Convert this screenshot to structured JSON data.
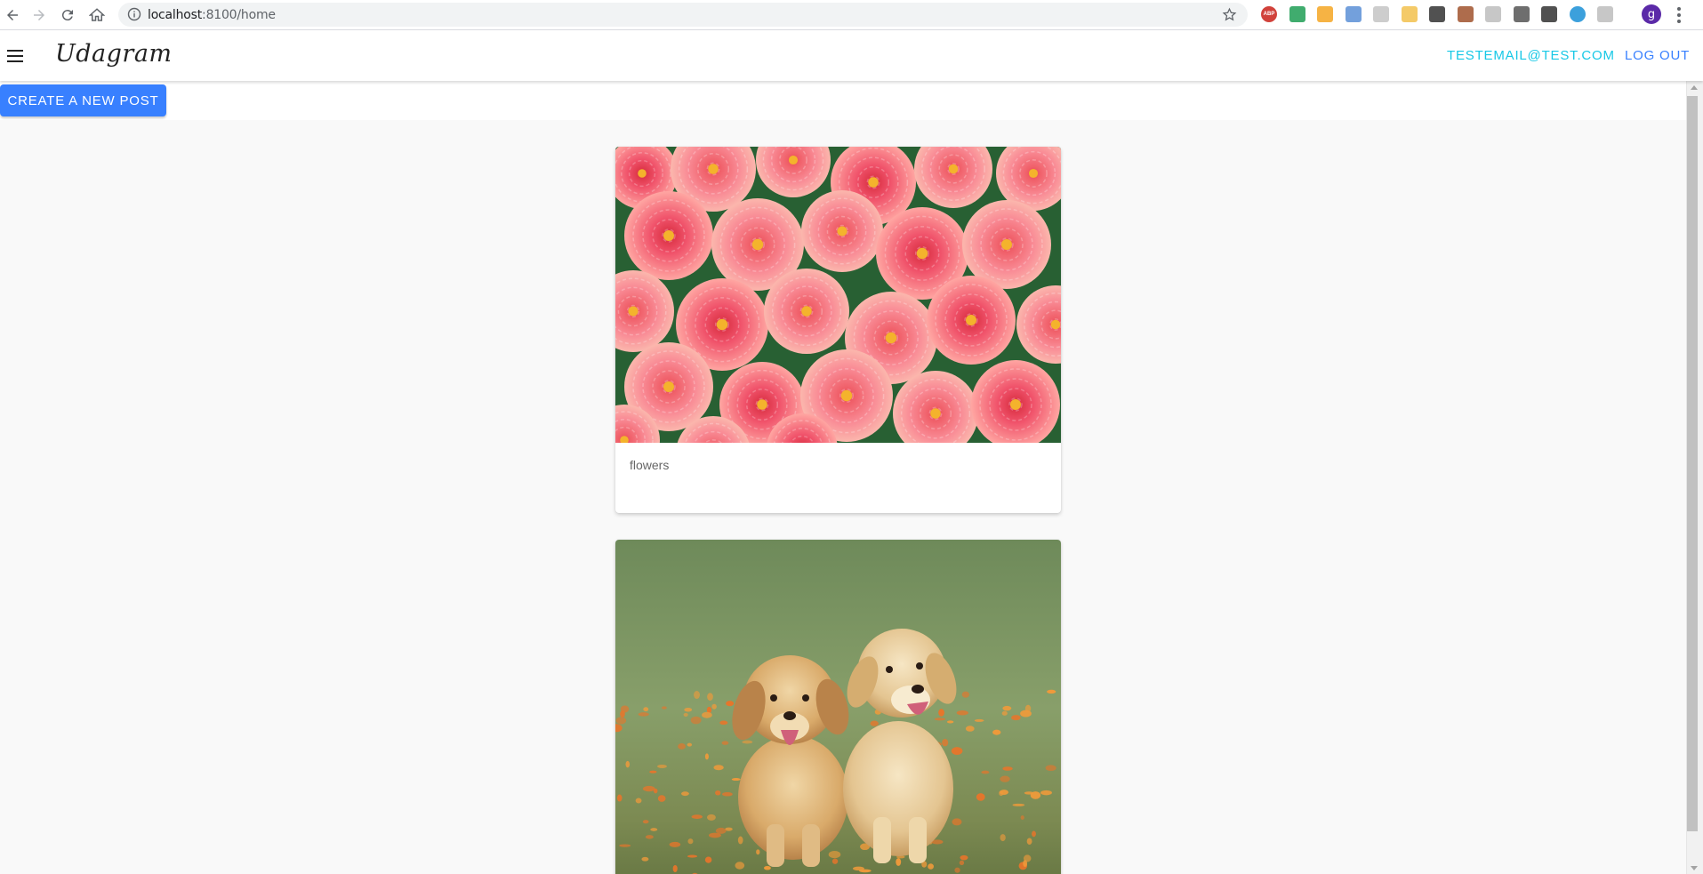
{
  "browser": {
    "url_host": "localhost",
    "url_path": ":8100/home",
    "avatar_letter": "g",
    "extensions": [
      {
        "name": "adblock-icon",
        "color": "#c9221a",
        "label": "ABP"
      },
      {
        "name": "sheets-icon",
        "color": "#1f9d55"
      },
      {
        "name": "gear-extension-icon",
        "color": "#f4a623"
      },
      {
        "name": "blue-circle-extension-icon",
        "color": "#5b8fd6"
      },
      {
        "name": "grid-extension-icon",
        "color": "#c4c4c4"
      },
      {
        "name": "note-extension-icon",
        "color": "#f2c14e"
      },
      {
        "name": "pen-extension-icon",
        "color": "#333333"
      },
      {
        "name": "pdf-extension-icon",
        "color": "#a0522d"
      },
      {
        "name": "clock-extension-icon",
        "color": "#bdbdbd"
      },
      {
        "name": "angular-extension-icon",
        "color": "#555555"
      },
      {
        "name": "eyedropper-extension-icon",
        "color": "#333333"
      },
      {
        "name": "ring-extension-icon",
        "color": "#1a8fd6"
      },
      {
        "name": "dots-extension-icon",
        "color": "#bdbdbd"
      }
    ]
  },
  "app": {
    "title": "Udagram",
    "user_email": "TESTEMAIL@TEST.COM",
    "logout_label": "LOG OUT",
    "create_post_label": "CREATE A NEW POST"
  },
  "feed": {
    "posts": [
      {
        "caption": "flowers",
        "image": "pink dahlia flowers"
      },
      {
        "caption": "",
        "image": "two golden retriever puppies"
      }
    ]
  },
  "colors": {
    "primary": "#3880ff",
    "email_link": "#17c8e6",
    "feed_background": "#f9f9f9"
  }
}
